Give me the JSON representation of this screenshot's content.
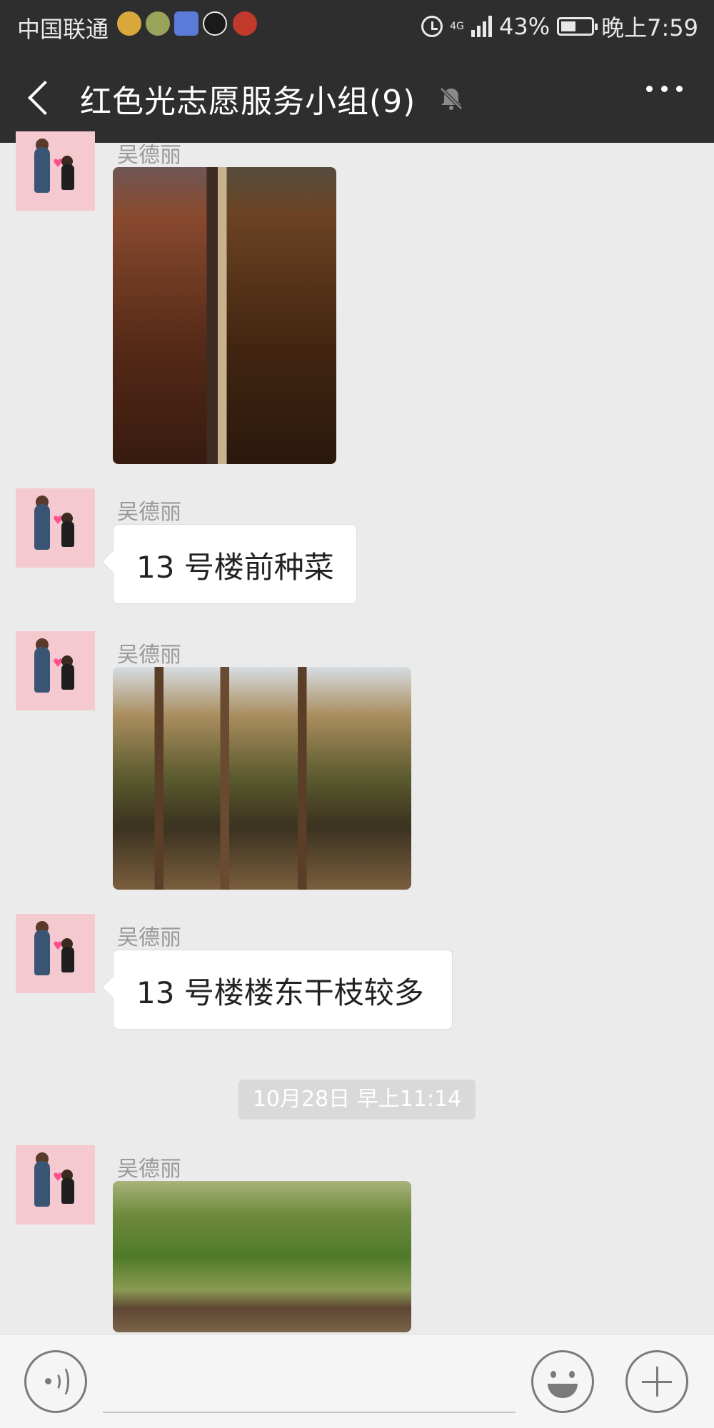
{
  "status_bar": {
    "carrier": "中国联通",
    "battery_percent": "43%",
    "time": "晚上7:59",
    "network": "4G",
    "notification_icons": [
      "mail-icon",
      "app-icon",
      "video-icon",
      "tiktok-icon",
      "news-icon"
    ]
  },
  "header": {
    "title": "红色光志愿服务小组(9)"
  },
  "messages": [
    {
      "sender": "吴德丽",
      "type": "image"
    },
    {
      "sender": "吴德丽",
      "type": "text",
      "text": "13 号楼前种菜"
    },
    {
      "sender": "吴德丽",
      "type": "image"
    },
    {
      "sender": "吴德丽",
      "type": "text",
      "text": "13 号楼楼东干枝较多"
    },
    {
      "sender": "吴德丽",
      "type": "image"
    }
  ],
  "timestamp": "10月28日 早上11:14",
  "colors": {
    "top_bar": "#2e2e2e",
    "chat_background": "#ebebeb",
    "bubble": "#ffffff",
    "avatar_background": "#f4c9d0"
  }
}
